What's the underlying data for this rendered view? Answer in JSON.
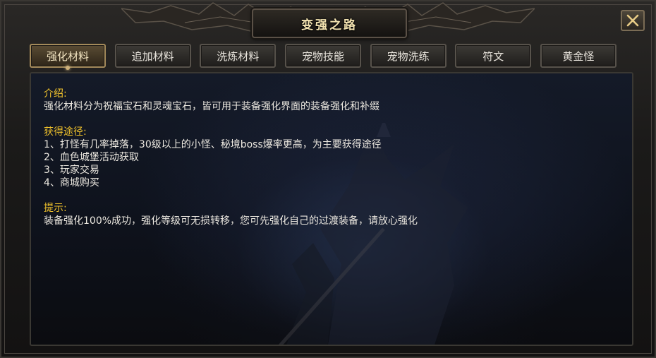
{
  "window": {
    "title": "变强之路",
    "close_icon": "close-icon",
    "accent_color": "#f0c22c"
  },
  "tabs": [
    {
      "label": "强化材料",
      "active": true
    },
    {
      "label": "追加材料",
      "active": false
    },
    {
      "label": "洗炼材料",
      "active": false
    },
    {
      "label": "宠物技能",
      "active": false
    },
    {
      "label": "宠物洗练",
      "active": false
    },
    {
      "label": "符文",
      "active": false
    },
    {
      "label": "黄金怪",
      "active": false
    }
  ],
  "content": {
    "intro_title": "介绍:",
    "intro_text": "强化材料分为祝福宝石和灵魂宝石，皆可用于装备强化界面的装备强化和补缀",
    "source_title": "获得途径:",
    "sources": [
      "1、打怪有几率掉落，30级以上的小怪、秘境boss爆率更高，为主要获得途径",
      "2、血色城堡活动获取",
      "3、玩家交易",
      "4、商城购买"
    ],
    "tip_title": "提示:",
    "tip_text": "装备强化100%成功，强化等级可无损转移，您可先强化自己的过渡装备，请放心强化"
  }
}
